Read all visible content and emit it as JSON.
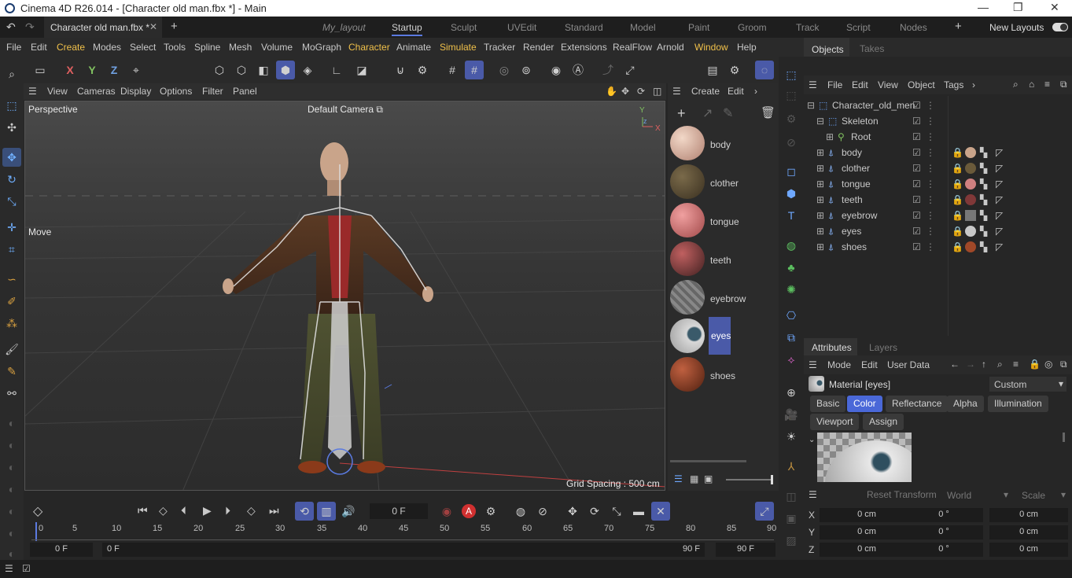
{
  "window": {
    "title": "Cinema 4D R26.014 - [Character old man.fbx *] - Main"
  },
  "tabs": {
    "doc": "Character old man.fbx *",
    "layouts": [
      "My_layout",
      "Startup",
      "Sculpt",
      "UVEdit",
      "Standard",
      "Model",
      "Paint",
      "Groom",
      "Track",
      "Script",
      "Nodes"
    ],
    "new_layouts": "New Layouts"
  },
  "menu": [
    "File",
    "Edit",
    "Create",
    "Modes",
    "Select",
    "Tools",
    "Spline",
    "Mesh",
    "Volume",
    "MoGraph",
    "Character",
    "Animate",
    "Simulate",
    "Tracker",
    "Render",
    "Extensions",
    "RealFlow",
    "Arnold",
    "Window",
    "Help"
  ],
  "viewport": {
    "menus": [
      "View",
      "Cameras",
      "Display",
      "Options",
      "Filter",
      "Panel"
    ],
    "name": "Perspective",
    "camera": "Default Camera",
    "tool": "Move",
    "grid": "Grid Spacing : 500 cm"
  },
  "materials": {
    "menus": [
      "Create",
      "Edit"
    ],
    "items": [
      "body",
      "clother",
      "tongue",
      "teeth",
      "eyebrow",
      "eyes",
      "shoes"
    ],
    "selected": "eyes"
  },
  "objects": {
    "tabs": [
      "Objects",
      "Takes"
    ],
    "menus": [
      "File",
      "Edit",
      "View",
      "Object",
      "Tags"
    ],
    "tree": [
      "Character_old_men",
      "Skeleton",
      "Root",
      "body",
      "clother",
      "tongue",
      "teeth",
      "eyebrow",
      "eyes",
      "shoes"
    ]
  },
  "attributes": {
    "tabs": [
      "Attributes",
      "Layers"
    ],
    "menus": [
      "Mode",
      "Edit",
      "User Data"
    ],
    "material": "Material [eyes]",
    "preset": "Custom",
    "tabs_row1": [
      "Basic",
      "Color",
      "Reflectance",
      "Alpha",
      "Illumination"
    ],
    "tabs_row2": [
      "Viewport",
      "Assign"
    ]
  },
  "coords": {
    "reset": "Reset Transform",
    "space": "World",
    "mode": "Scale",
    "rows": [
      {
        "axis": "X",
        "pos": "0 cm",
        "rot": "0 °",
        "size": "0 cm"
      },
      {
        "axis": "Y",
        "pos": "0 cm",
        "rot": "0 °",
        "size": "0 cm"
      },
      {
        "axis": "Z",
        "pos": "0 cm",
        "rot": "0 °",
        "size": "0 cm"
      }
    ]
  },
  "timeline": {
    "frame": "0 F",
    "ticks": [
      "0",
      "5",
      "10",
      "15",
      "20",
      "25",
      "30",
      "35",
      "40",
      "45",
      "50",
      "55",
      "60",
      "65",
      "70",
      "75",
      "80",
      "85",
      "90"
    ],
    "start": "0 F",
    "range_start": "0 F",
    "range_end": "90 F",
    "end": "90 F"
  },
  "toolbar": {
    "axis": [
      "X",
      "Y",
      "Z"
    ]
  }
}
